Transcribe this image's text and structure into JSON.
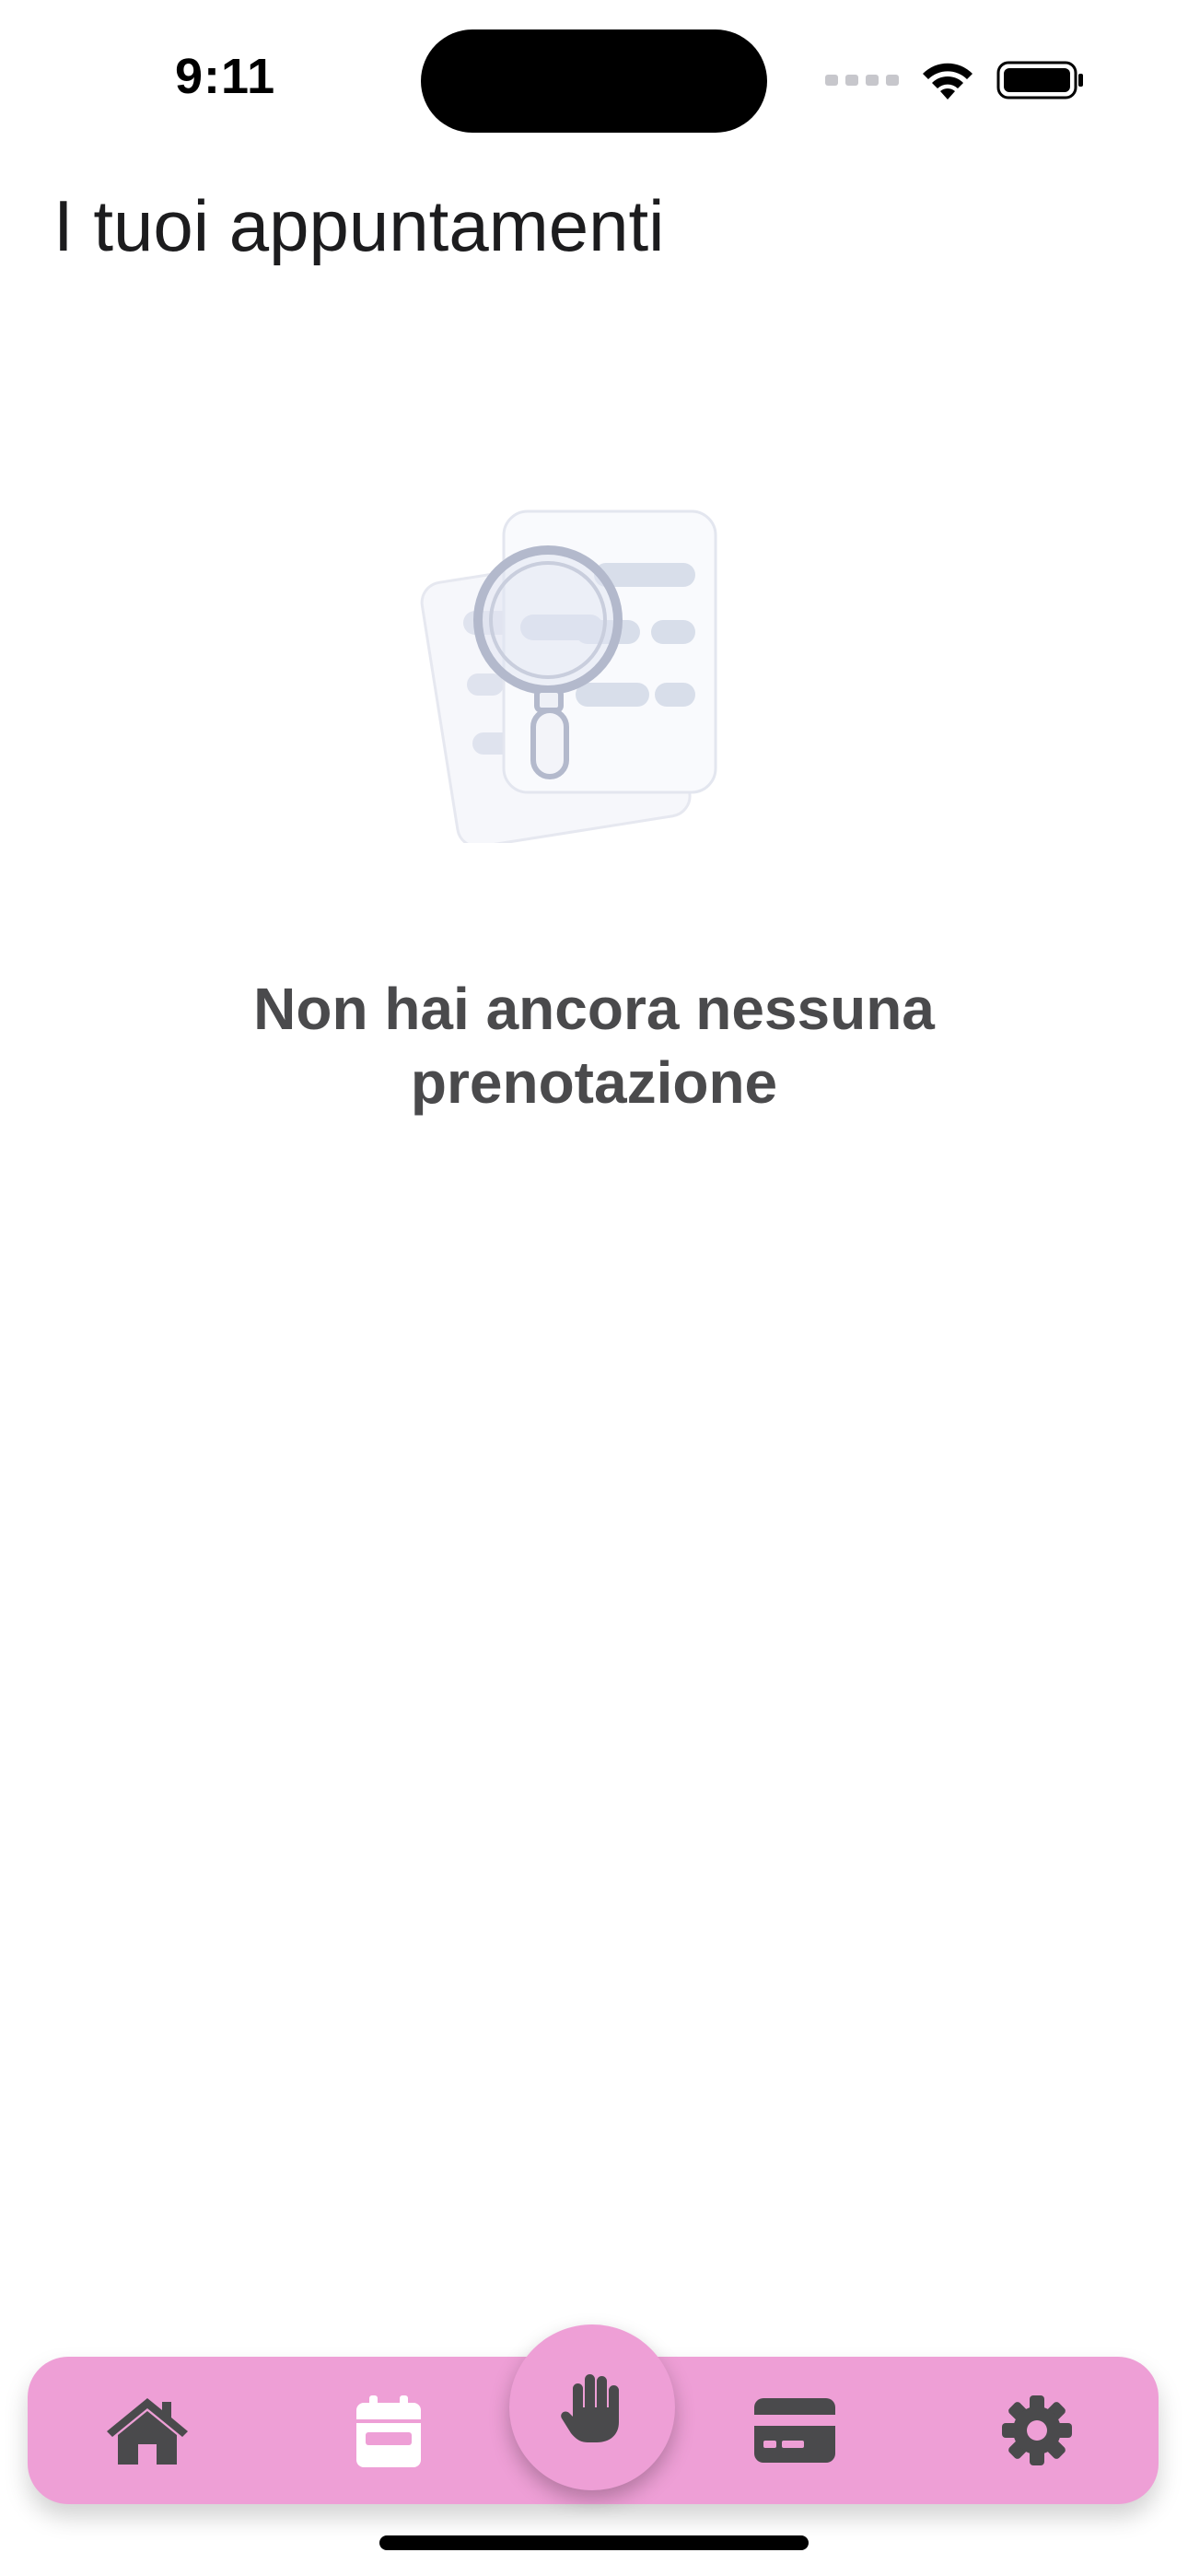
{
  "status_bar": {
    "time": "9:11"
  },
  "header": {
    "title": "I tuoi appuntamenti"
  },
  "empty_state": {
    "icon": "document-search-illustration",
    "message": "Non hai ancora nessuna prenotazione"
  },
  "bottom_nav": {
    "background_color": "#ee9fd6",
    "icon_color": "#4a4a4c",
    "active_icon_color": "#ffffff",
    "items": [
      {
        "icon": "home-icon",
        "active": false
      },
      {
        "icon": "calendar-icon",
        "active": true
      },
      {
        "icon": "hand-icon",
        "active": false,
        "center": true
      },
      {
        "icon": "credit-card-icon",
        "active": false
      },
      {
        "icon": "gear-icon",
        "active": false
      }
    ]
  }
}
